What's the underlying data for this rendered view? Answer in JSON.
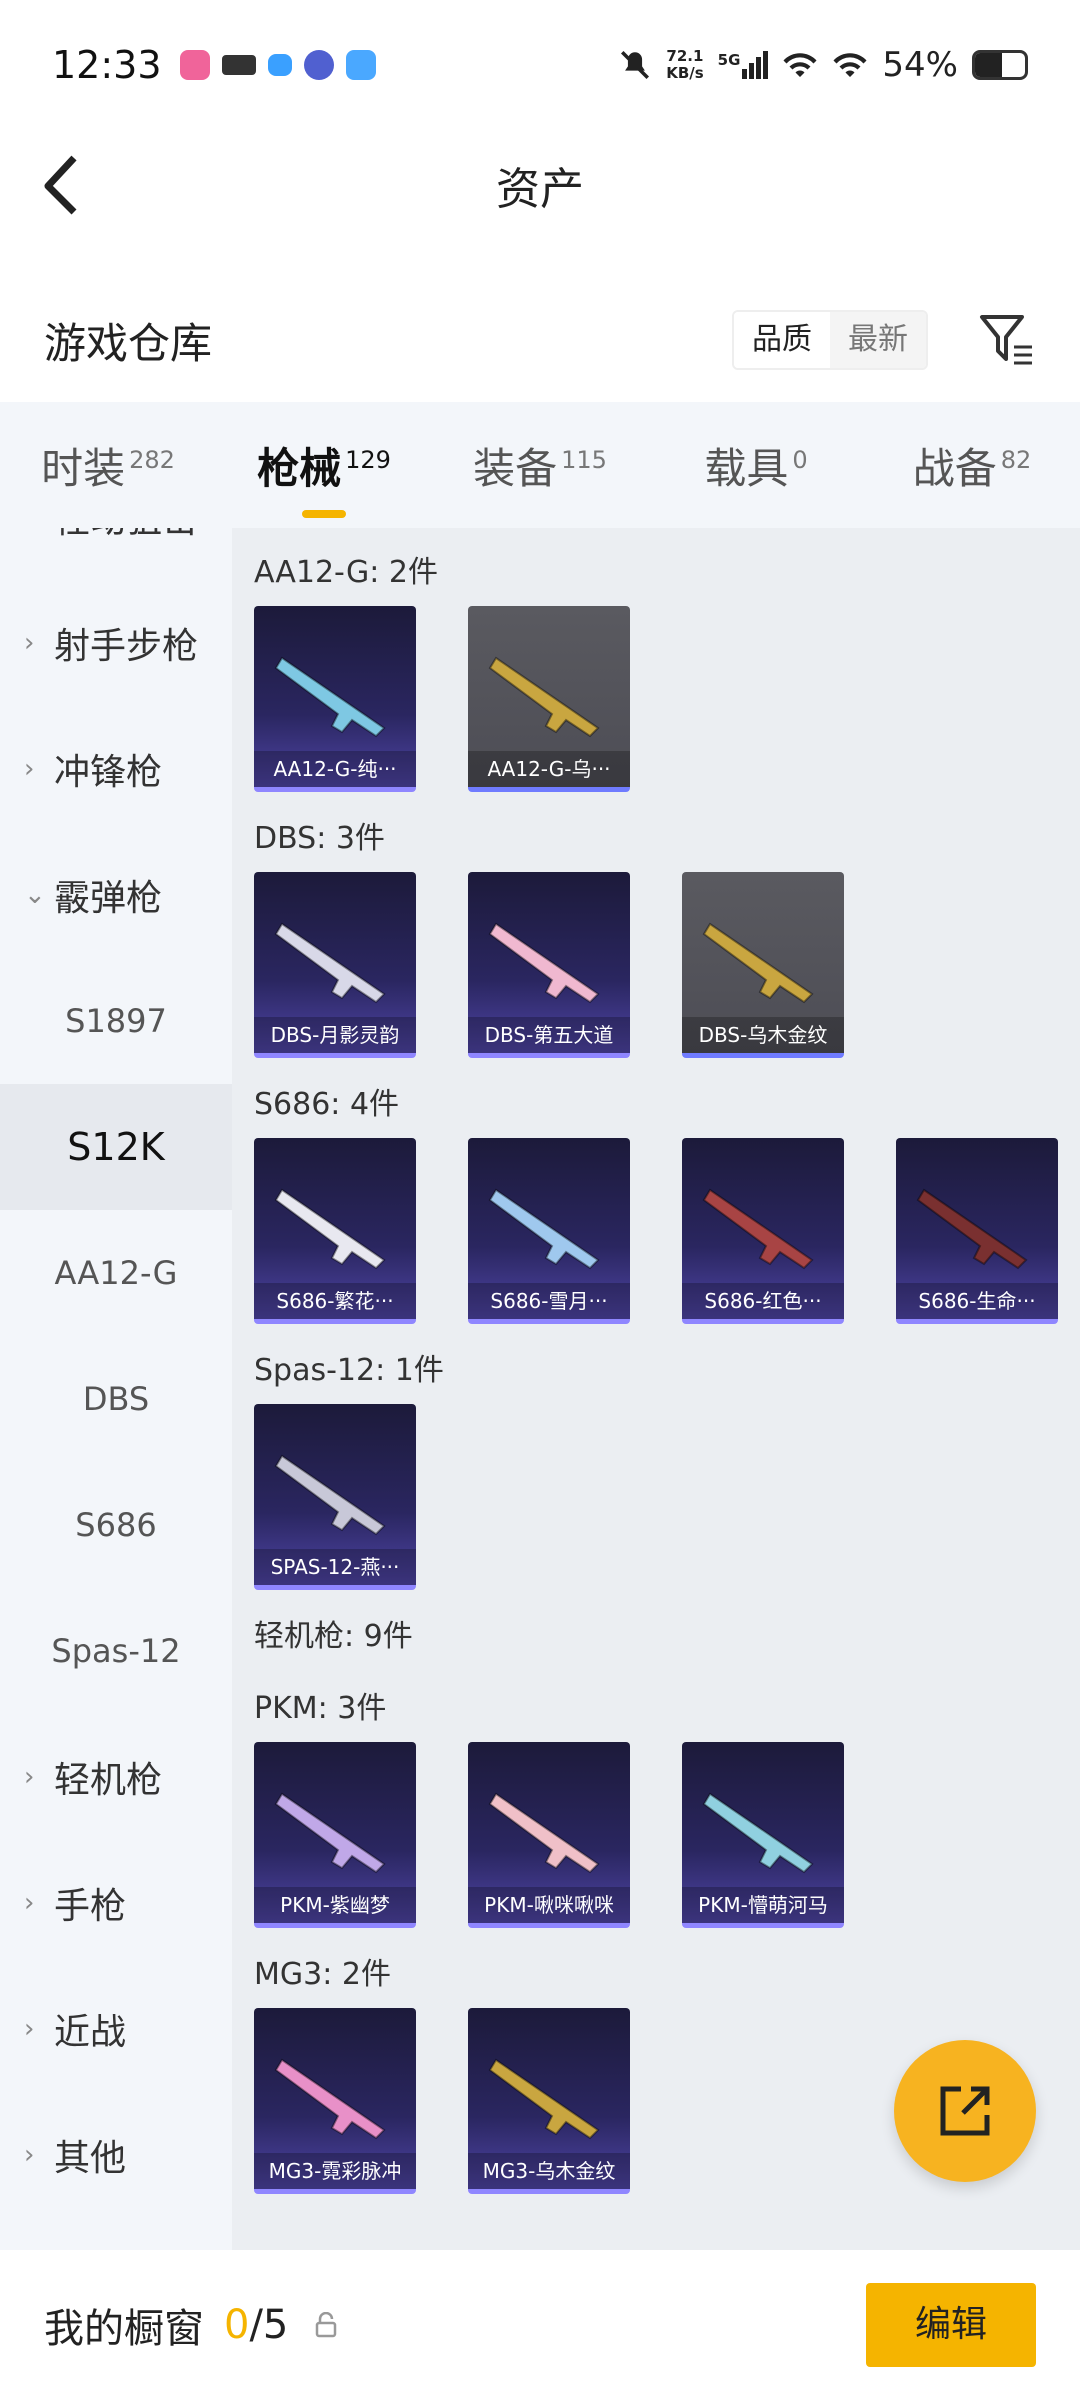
{
  "status_bar": {
    "time": "12:33",
    "net_speed_value": "72.1",
    "net_speed_unit": "KB/s",
    "network": "5G",
    "battery": "54%",
    "battery_level": 0.54
  },
  "header": {
    "title": "资产"
  },
  "warehouse": {
    "title": "游戏仓库",
    "sort_options": [
      "品质",
      "最新"
    ],
    "active_sort": "品质"
  },
  "tabs": [
    {
      "label": "时装",
      "count": "282"
    },
    {
      "label": "枪械",
      "count": "129",
      "active": true
    },
    {
      "label": "装备",
      "count": "115"
    },
    {
      "label": "载具",
      "count": "0"
    },
    {
      "label": "战备",
      "count": "82"
    }
  ],
  "sidebar": [
    {
      "label": "栓动狙击",
      "type": "cat",
      "chevron": "›"
    },
    {
      "label": "射手步枪",
      "type": "cat",
      "chevron": "›"
    },
    {
      "label": "冲锋枪",
      "type": "cat",
      "chevron": "›"
    },
    {
      "label": "霰弹枪",
      "type": "cat",
      "chevron": "⌄"
    },
    {
      "label": "S1897",
      "type": "sub"
    },
    {
      "label": "S12K",
      "type": "sub",
      "selected": true
    },
    {
      "label": "AA12-G",
      "type": "sub"
    },
    {
      "label": "DBS",
      "type": "sub"
    },
    {
      "label": "S686",
      "type": "sub"
    },
    {
      "label": "Spas-12",
      "type": "sub"
    },
    {
      "label": "轻机枪",
      "type": "cat",
      "chevron": "›"
    },
    {
      "label": "手枪",
      "type": "cat",
      "chevron": "›"
    },
    {
      "label": "近战",
      "type": "cat",
      "chevron": "›"
    },
    {
      "label": "其他",
      "type": "cat",
      "chevron": "›"
    }
  ],
  "groups": [
    {
      "title": "AA12-G: 2件",
      "items": [
        {
          "label": "AA12-G-纯···",
          "tint": "#7ec8e3",
          "gray": false
        },
        {
          "label": "AA12-G-乌···",
          "tint": "#c9a640",
          "gray": true
        }
      ]
    },
    {
      "title": "DBS: 3件",
      "items": [
        {
          "label": "DBS-月影灵韵",
          "tint": "#d8d8e8",
          "gray": false
        },
        {
          "label": "DBS-第五大道",
          "tint": "#f0b8d0",
          "gray": false
        },
        {
          "label": "DBS-乌木金纹",
          "tint": "#c9a640",
          "gray": true
        }
      ]
    },
    {
      "title": "S686: 4件",
      "items": [
        {
          "label": "S686-繁花···",
          "tint": "#e8e8f0",
          "gray": false
        },
        {
          "label": "S686-雪月···",
          "tint": "#9fc8ee",
          "gray": false
        },
        {
          "label": "S686-红色···",
          "tint": "#a84444",
          "gray": false
        },
        {
          "label": "S686-生命···",
          "tint": "#7a3030",
          "gray": false
        }
      ]
    },
    {
      "title": "Spas-12: 1件",
      "items": [
        {
          "label": "SPAS-12-燕···",
          "tint": "#c8c8d8",
          "gray": false
        }
      ]
    },
    {
      "title": "轻机枪: 9件",
      "items": []
    },
    {
      "title": "PKM: 3件",
      "items": [
        {
          "label": "PKM-紫幽梦",
          "tint": "#c0a8e8",
          "gray": false
        },
        {
          "label": "PKM-啾咪啾咪",
          "tint": "#f0c0c8",
          "gray": false
        },
        {
          "label": "PKM-懵萌河马",
          "tint": "#90d0e0",
          "gray": false
        }
      ]
    },
    {
      "title": "MG3: 2件",
      "items": [
        {
          "label": "MG3-霓彩脉冲",
          "tint": "#e890c8",
          "gray": false
        },
        {
          "label": "MG3-乌木金纹",
          "tint": "#c9a640",
          "gray": false
        }
      ]
    }
  ],
  "bottom": {
    "label": "我的橱窗",
    "count_used": "0",
    "count_total": "/5",
    "edit_label": "编辑"
  },
  "colors": {
    "accent": "#f5b400",
    "fab": "#f7b320"
  }
}
